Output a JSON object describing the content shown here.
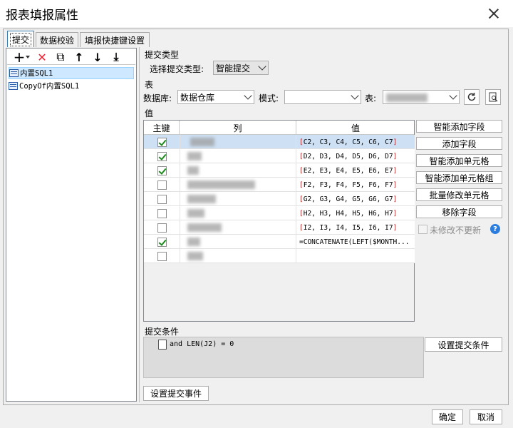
{
  "window": {
    "title": "报表填报属性"
  },
  "tabs": [
    {
      "label": "提交",
      "active": true
    },
    {
      "label": "数据校验",
      "active": false
    },
    {
      "label": "填报快捷键设置",
      "active": false
    }
  ],
  "toolbar": {
    "add": "+",
    "delete": "✕",
    "copy": "⧉",
    "up": "↑",
    "down": "↓",
    "move_bottom": "⤓"
  },
  "tree": {
    "items": [
      {
        "label": "内置SQL1",
        "selected": true
      },
      {
        "label": "CopyOf内置SQL1",
        "selected": false
      }
    ]
  },
  "submit_type": {
    "section": "提交类型",
    "label": "选择提交类型:",
    "value": "智能提交"
  },
  "table_section": {
    "section": "表",
    "db_label": "数据库:",
    "db_value": "数据仓库",
    "schema_label": "模式:",
    "schema_value": "",
    "table_label": "表:"
  },
  "values_section": {
    "section": "值",
    "headers": {
      "key": "主键",
      "column": "列",
      "value": "值"
    },
    "rows": [
      {
        "key": true,
        "value": "[C2, C3, C4, C5, C6, C7]",
        "selected": true
      },
      {
        "key": true,
        "value": "[D2, D3, D4, D5, D6, D7]"
      },
      {
        "key": true,
        "value": "[E2, E3, E4, E5, E6, E7]"
      },
      {
        "key": false,
        "value": "[F2, F3, F4, F5, F6, F7]"
      },
      {
        "key": false,
        "value": "[G2, G3, G4, G5, G6, G7]"
      },
      {
        "key": false,
        "value": "[H2, H3, H4, H5, H6, H7]"
      },
      {
        "key": false,
        "value": "[I2, I3, I4, I5, I6, I7]"
      },
      {
        "key": true,
        "value": "=CONCATENATE(LEFT($MONTH..."
      },
      {
        "key": false,
        "value": ""
      }
    ]
  },
  "side_buttons": [
    "智能添加字段",
    "添加字段",
    "智能添加单元格",
    "智能添加单元格组",
    "批量修改单元格",
    "移除字段"
  ],
  "no_update_unmodified": {
    "label": "未修改不更新",
    "checked": false
  },
  "help_icon": "?",
  "condition_section": {
    "section": "提交条件",
    "condition": "and LEN(J2) = 0",
    "set_button": "设置提交条件"
  },
  "event_button": "设置提交事件",
  "footer": {
    "ok": "确定",
    "cancel": "取消"
  }
}
